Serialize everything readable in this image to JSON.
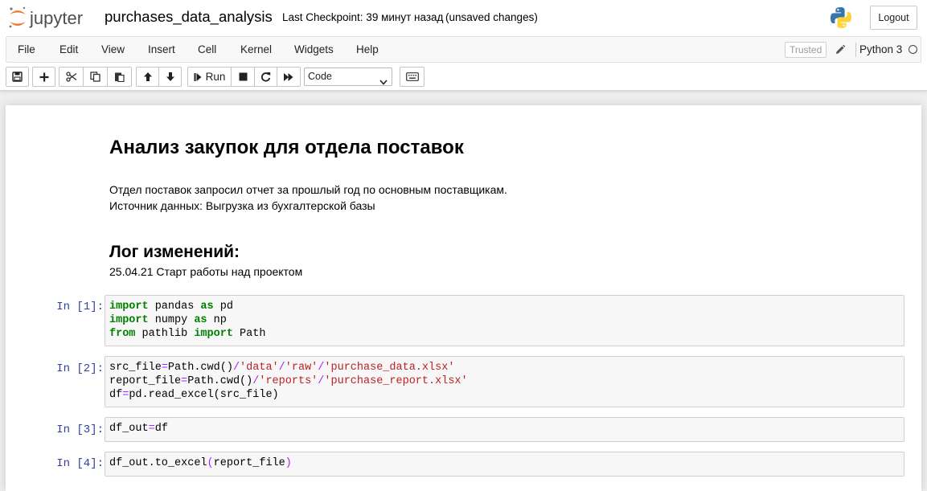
{
  "header": {
    "logo_text": "jupyter",
    "notebook_name": "purchases_data_analysis",
    "checkpoint": "Last Checkpoint: 39 минут назад",
    "save_status": "(unsaved changes)",
    "logout_label": "Logout",
    "python_logo_icon": "python-logo-icon"
  },
  "menubar": {
    "items": [
      "File",
      "Edit",
      "View",
      "Insert",
      "Cell",
      "Kernel",
      "Widgets",
      "Help"
    ],
    "trusted": "Trusted",
    "kernel": "Python 3",
    "kernel_status_icon": "kernel-idle-icon",
    "edit_icon": "pencil-icon"
  },
  "toolbar": {
    "run_label": "Run",
    "cell_type": "Code",
    "icons": [
      "save-icon",
      "plus-icon",
      "scissors-icon",
      "copy-icon",
      "paste-icon",
      "arrow-up-icon",
      "arrow-down-icon",
      "step-forward-icon",
      "stop-icon",
      "restart-icon",
      "fast-forward-icon",
      "keyboard-icon"
    ]
  },
  "notebook": {
    "markdown": {
      "title": "Анализ закупок для отдела поставок",
      "para1_line1": "Отдел поставок запросил отчет за прошлый год по основным поставщикам.",
      "para1_line2": "Источник данных: Выгрузка из бухгалтерской базы",
      "changelog_heading": "Лог изменений:",
      "changelog_entry": "25.04.21 Старт работы над проектом"
    },
    "cells": [
      {
        "prompt": "In [1]:",
        "lines": [
          [
            {
              "t": "import",
              "c": "kw"
            },
            {
              "t": " pandas ",
              "c": "tok"
            },
            {
              "t": "as",
              "c": "kw"
            },
            {
              "t": " pd",
              "c": "tok"
            }
          ],
          [
            {
              "t": "import",
              "c": "kw"
            },
            {
              "t": " numpy ",
              "c": "tok"
            },
            {
              "t": "as",
              "c": "kw"
            },
            {
              "t": " np",
              "c": "tok"
            }
          ],
          [
            {
              "t": "from",
              "c": "kw"
            },
            {
              "t": " pathlib ",
              "c": "tok"
            },
            {
              "t": "import",
              "c": "kw"
            },
            {
              "t": " Path",
              "c": "tok"
            }
          ]
        ]
      },
      {
        "prompt": "In [2]:",
        "lines": [
          [
            {
              "t": "src_file",
              "c": "tok"
            },
            {
              "t": "=",
              "c": "op"
            },
            {
              "t": "Path.cwd()",
              "c": "tok"
            },
            {
              "t": "/",
              "c": "op"
            },
            {
              "t": "'data'",
              "c": "str"
            },
            {
              "t": "/",
              "c": "op"
            },
            {
              "t": "'raw'",
              "c": "str"
            },
            {
              "t": "/",
              "c": "op"
            },
            {
              "t": "'purchase_data.xlsx'",
              "c": "str"
            }
          ],
          [
            {
              "t": "report_file",
              "c": "tok"
            },
            {
              "t": "=",
              "c": "op"
            },
            {
              "t": "Path.cwd()",
              "c": "tok"
            },
            {
              "t": "/",
              "c": "op"
            },
            {
              "t": "'reports'",
              "c": "str"
            },
            {
              "t": "/",
              "c": "op"
            },
            {
              "t": "'purchase_report.xlsx'",
              "c": "str"
            }
          ],
          [
            {
              "t": "df",
              "c": "tok"
            },
            {
              "t": "=",
              "c": "op"
            },
            {
              "t": "pd.read_excel(src_file)",
              "c": "tok"
            }
          ]
        ]
      },
      {
        "prompt": "In [3]:",
        "lines": [
          [
            {
              "t": "df_out",
              "c": "tok"
            },
            {
              "t": "=",
              "c": "op"
            },
            {
              "t": "df",
              "c": "tok"
            }
          ]
        ]
      },
      {
        "prompt": "In [4]:",
        "lines": [
          [
            {
              "t": "df_out.to_excel",
              "c": "tok"
            },
            {
              "t": "(",
              "c": "op"
            },
            {
              "t": "report_file",
              "c": "tok"
            },
            {
              "t": ")",
              "c": "op"
            }
          ]
        ]
      }
    ]
  },
  "colors": {
    "prompt": "#303f9f",
    "keyword": "#008000",
    "string": "#ba2121",
    "operator": "#aa22ff",
    "jupyter_orange": "#f37726"
  }
}
